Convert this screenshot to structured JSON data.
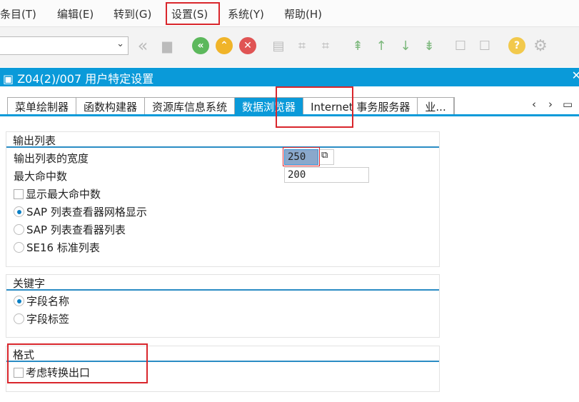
{
  "menu": [
    "条目(T)",
    "编辑(E)",
    "转到(G)",
    "设置(S)",
    "系统(Y)",
    "帮助(H)"
  ],
  "toolbar": {
    "command_value": "",
    "icons": [
      "back-double-icon",
      "save-icon",
      "back-icon",
      "exit-icon",
      "cancel-icon",
      "print-icon",
      "find-icon",
      "find-next-icon",
      "first-page-icon",
      "previous-page-icon",
      "next-page-icon",
      "last-page-icon",
      "new-session-icon",
      "shortcut-icon",
      "help-icon",
      "settings-icon"
    ]
  },
  "title": "Z04(2)/007 用户特定设置",
  "tabs": [
    "菜单绘制器",
    "函数构建器",
    "资源库信息系统",
    "数据浏览器",
    "Internet 事务服务器",
    "业..."
  ],
  "active_tab": "数据浏览器",
  "groups": {
    "output": {
      "title": "输出列表",
      "width_label": "输出列表的宽度",
      "width_value": "250",
      "max_label": "最大命中数",
      "max_value": "200",
      "show_max": "显示最大命中数",
      "radios": [
        "SAP 列表查看器网格显示",
        "SAP 列表查看器列表",
        "SE16 标准列表"
      ],
      "selected": 0
    },
    "keywords": {
      "title": "关键字",
      "radios": [
        "字段名称",
        "字段标签"
      ],
      "selected": 0
    },
    "format": {
      "title": "格式",
      "checkbox": "考虑转换出口"
    }
  },
  "colors": {
    "accent": "#0a9ad9",
    "highlight": "#d9262c"
  }
}
